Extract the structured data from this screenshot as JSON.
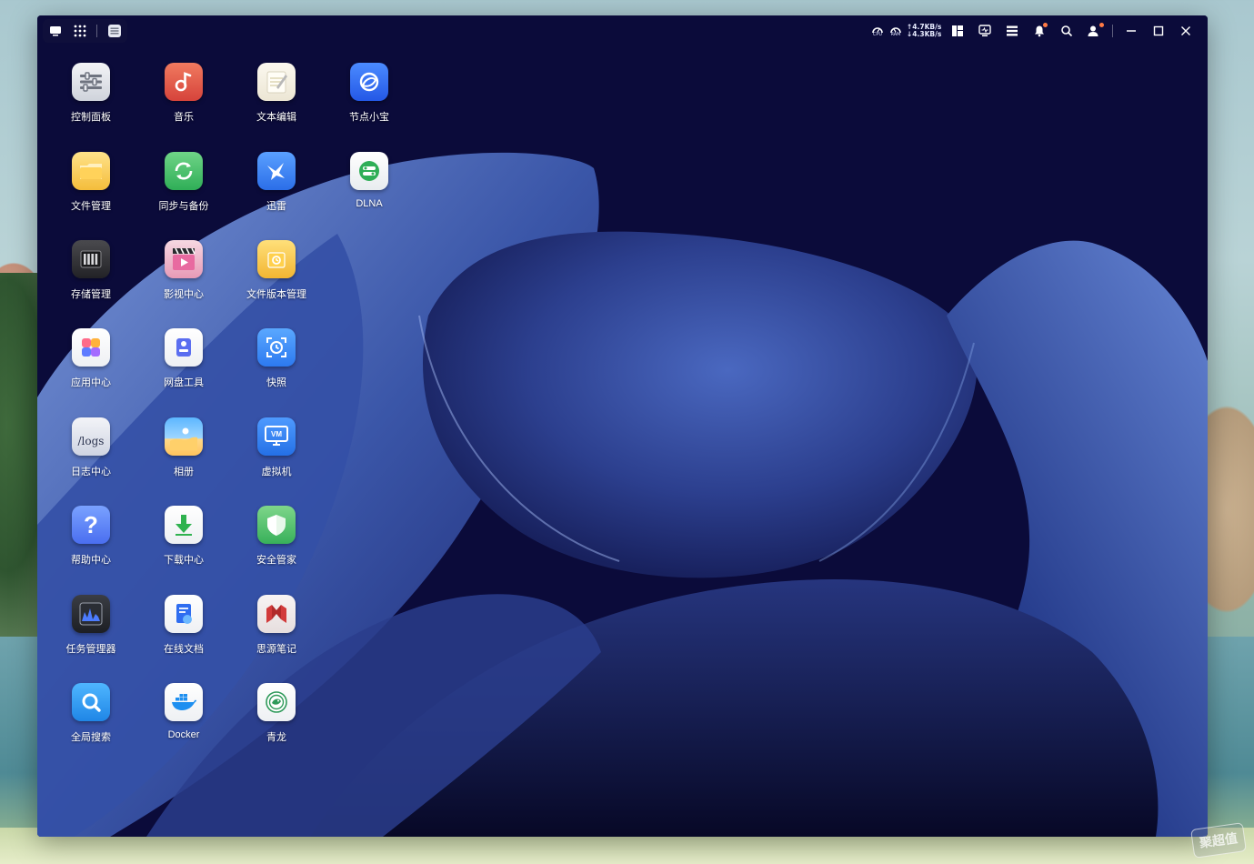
{
  "taskbar": {
    "net_up": "↑4.7KB/s",
    "net_down": "↓4.3KB/s",
    "cpu_label": "CPU",
    "ram_label": "RAM"
  },
  "apps": [
    {
      "label": "控制面板"
    },
    {
      "label": "音乐"
    },
    {
      "label": "文本编辑"
    },
    {
      "label": "节点小宝"
    },
    {
      "label": "文件管理"
    },
    {
      "label": "同步与备份"
    },
    {
      "label": "迅雷"
    },
    {
      "label": "DLNA"
    },
    {
      "label": "存储管理"
    },
    {
      "label": "影视中心"
    },
    {
      "label": "文件版本管理"
    },
    {
      "label": "应用中心"
    },
    {
      "label": "网盘工具"
    },
    {
      "label": "快照"
    },
    {
      "label": "日志中心",
      "icon_text": "/logs"
    },
    {
      "label": "相册"
    },
    {
      "label": "虚拟机",
      "icon_text": "VM"
    },
    {
      "label": "帮助中心",
      "icon_text": "?"
    },
    {
      "label": "下载中心"
    },
    {
      "label": "安全管家"
    },
    {
      "label": "任务管理器"
    },
    {
      "label": "在线文档"
    },
    {
      "label": "思源笔记"
    },
    {
      "label": "全局搜索"
    },
    {
      "label": "Docker"
    },
    {
      "label": "青龙"
    }
  ],
  "watermark": "聚超值",
  "colors": {
    "wallpaper_bg": "#0b0b3a",
    "petal": "#3a52a0",
    "accent_dot": "#ff7a45"
  }
}
